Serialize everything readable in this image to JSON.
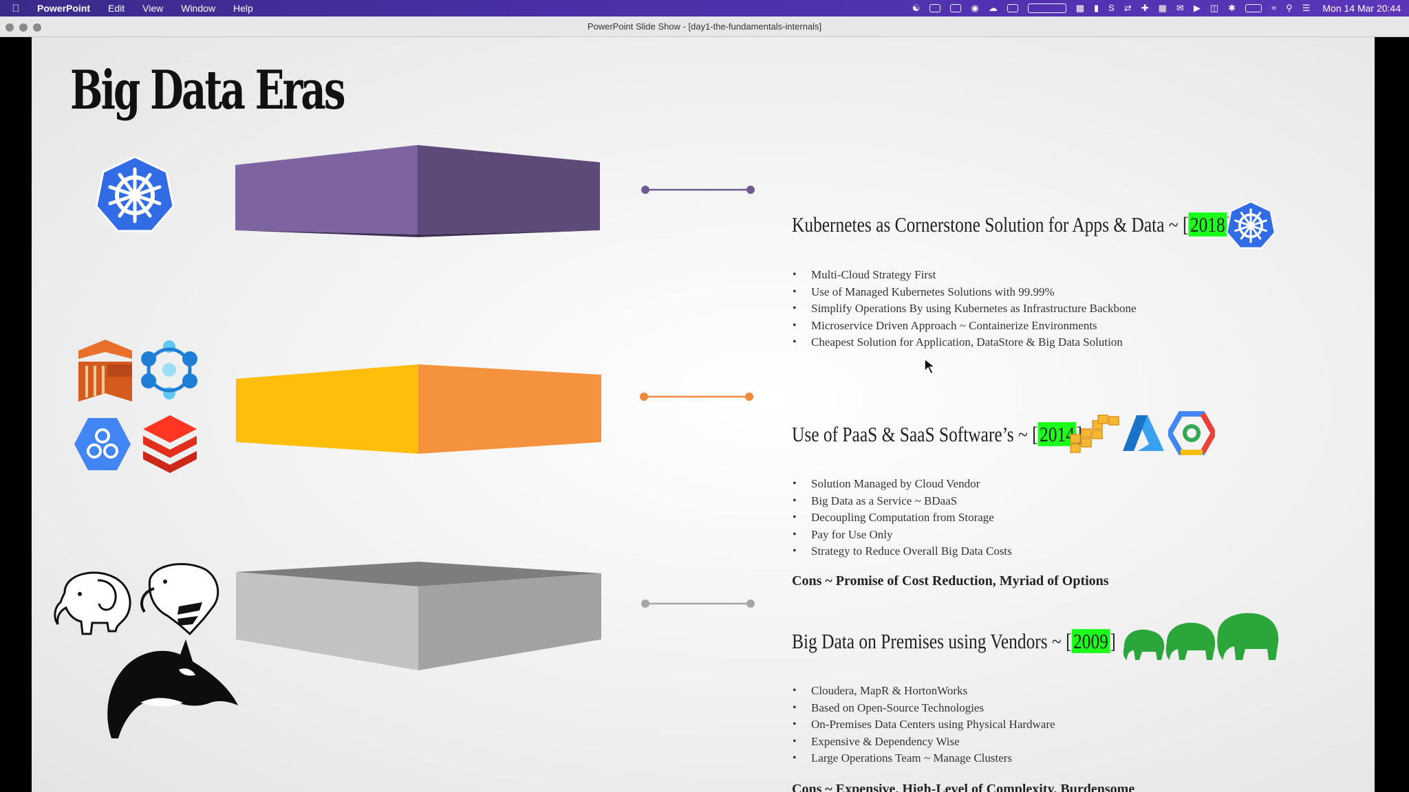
{
  "menubar": {
    "app_name": "PowerPoint",
    "menus": [
      "Edit",
      "View",
      "Window",
      "Help"
    ],
    "clock": "Mon 14 Mar  20:44"
  },
  "window": {
    "title": "PowerPoint Slide Show - [day1-the-fundamentals-internals]"
  },
  "slide": {
    "title": "Big Data Eras",
    "eras": [
      {
        "title_prefix": "Kubernetes as Cornerstone Solution for Apps & Data ~ [",
        "year": "2018",
        "title_suffix": "]",
        "bullets": [
          "Multi-Cloud Strategy First",
          "Use of Managed Kubernetes Solutions with 99.99%",
          "Simplify Operations By using Kubernetes as Infrastructure Backbone",
          "Microservice Driven Approach ~ Containerize Environments",
          "Cheapest Solution for Application, DataStore & Big Data Solution"
        ],
        "color": "#7d64a0",
        "cons": ""
      },
      {
        "title_prefix": "Use of PaaS & SaaS Software’s ~ [",
        "year": "2014",
        "title_suffix": "]",
        "bullets": [
          "Solution Managed by Cloud Vendor",
          "Big Data as a Service ~ BDaaS",
          "Decoupling Computation from Storage",
          "Pay for Use Only",
          "Strategy to Reduce Overall Big Data Costs"
        ],
        "color": "#f5923e",
        "cons": "Cons ~ Promise of Cost Reduction, Myriad of Options"
      },
      {
        "title_prefix": "Big Data on Premises using Vendors ~ [",
        "year": "2009",
        "title_suffix": "]",
        "bullets": [
          "Cloudera, MapR & HortonWorks",
          "Based on Open-Source Technologies",
          "On-Premises Data Centers using Physical Hardware",
          "Expensive & Dependency Wise",
          "Large Operations Team ~ Manage Clusters"
        ],
        "color": "#a8a8a8",
        "cons": "Cons ~ Expensive, High-Level of Complexity, Burdensome"
      }
    ]
  },
  "icons": {
    "kubernetes": "kubernetes-icon",
    "aws_emr": "aws-emr-icon",
    "azure_hdinsight": "azure-hdinsight-icon",
    "gcp_dataproc": "gcp-dataproc-icon",
    "databricks": "databricks-icon",
    "aws": "aws-icon",
    "azure": "azure-icon",
    "gcp": "gcp-icon",
    "hadoop": "hadoop-elephant-icon",
    "hive": "hive-icon",
    "mysql": "orca-icon"
  }
}
